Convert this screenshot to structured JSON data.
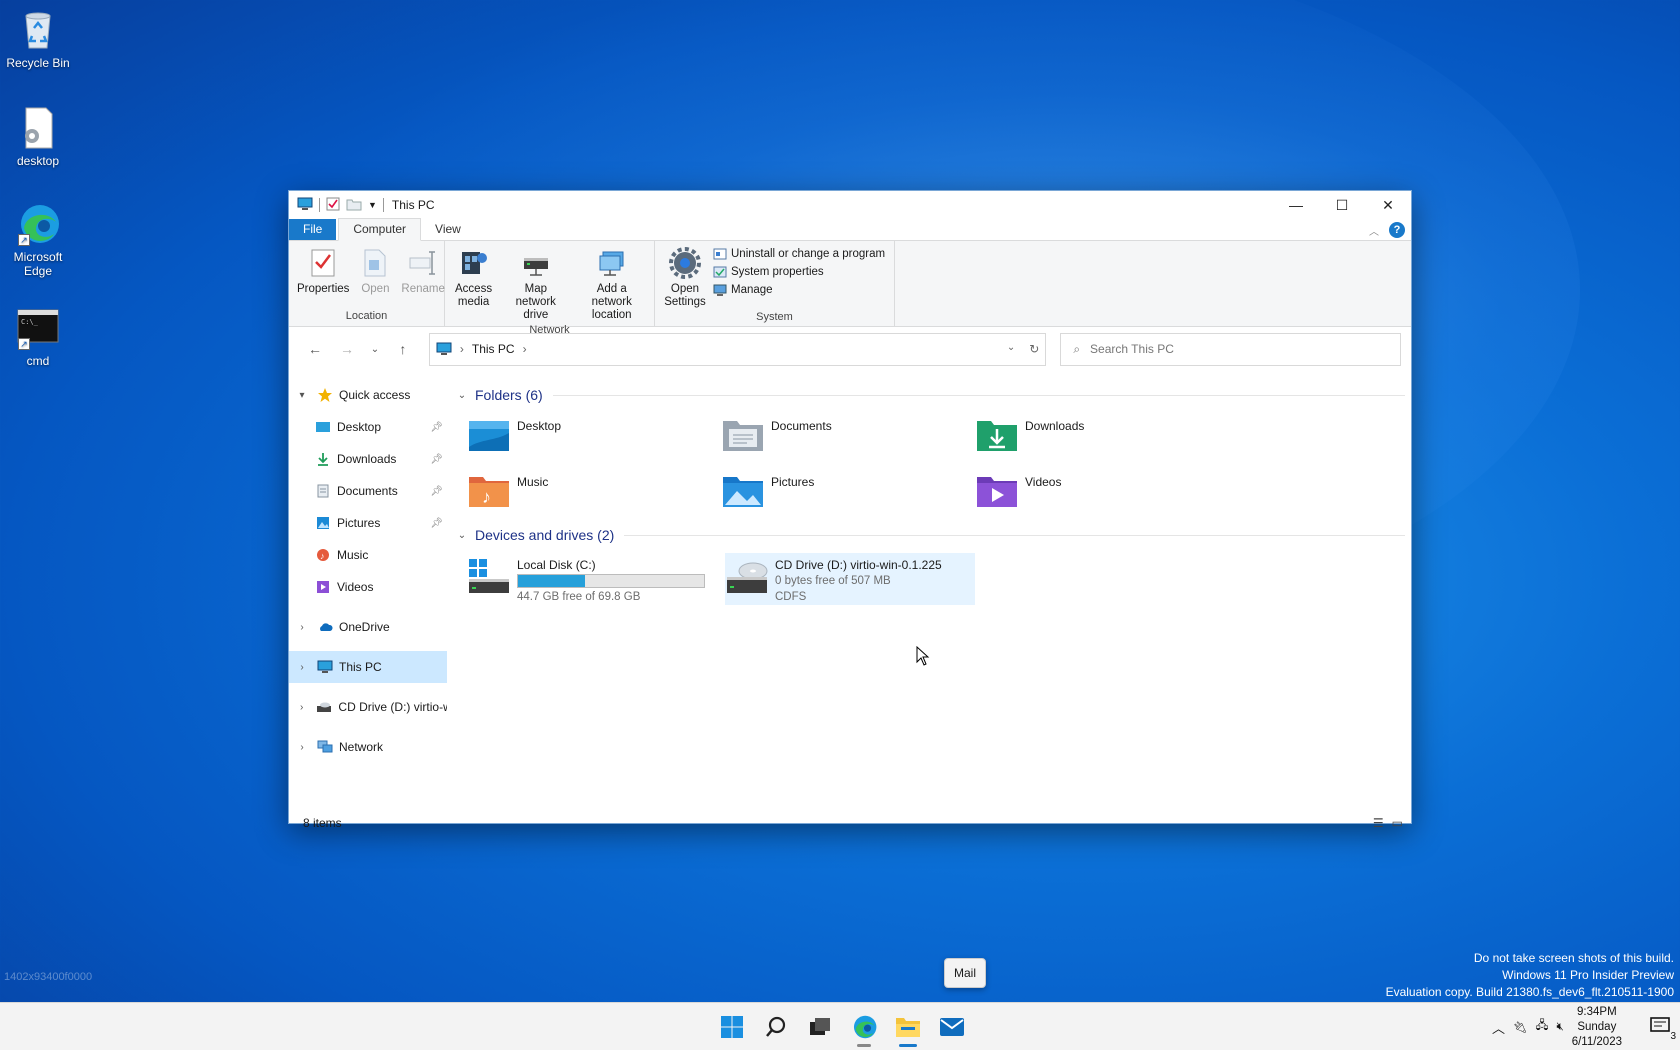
{
  "desktop": {
    "icons": [
      {
        "label": "Recycle Bin"
      },
      {
        "label": "desktop"
      },
      {
        "label": "Microsoft Edge"
      },
      {
        "label": "cmd"
      }
    ],
    "watermark": {
      "line1": "Do not take screen shots of this build.",
      "line2": "Windows 11 Pro Insider Preview",
      "line3": "Evaluation copy. Build 21380.fs_dev6_flt.210511-1900"
    },
    "faint_text": "1402x93400f0000"
  },
  "window": {
    "title": "This PC",
    "ribbon_tabs": [
      "File",
      "Computer",
      "View"
    ],
    "active_tab": "Computer",
    "groups": {
      "location": {
        "label": "Location",
        "buttons": [
          "Properties",
          "Open",
          "Rename"
        ]
      },
      "network": {
        "label": "Network",
        "buttons": [
          "Access media",
          "Map network drive",
          "Add a network location"
        ]
      },
      "system": {
        "label": "System",
        "open_settings": "Open Settings",
        "small": [
          "Uninstall or change a program",
          "System properties",
          "Manage"
        ]
      }
    },
    "address": {
      "path": "This PC",
      "search_placeholder": "Search This PC"
    },
    "nav": {
      "quick_access": "Quick access",
      "items": [
        "Desktop",
        "Downloads",
        "Documents",
        "Pictures",
        "Music",
        "Videos"
      ],
      "onedrive": "OneDrive",
      "this_pc": "This PC",
      "cd_drive": "CD Drive (D:) virtio-w",
      "network": "Network"
    },
    "folders_header": "Folders (6)",
    "folders": [
      "Desktop",
      "Documents",
      "Downloads",
      "Music",
      "Pictures",
      "Videos"
    ],
    "drives_header": "Devices and drives (2)",
    "drives": [
      {
        "name": "Local Disk (C:)",
        "free": "44.7 GB free of 69.8 GB",
        "used_fraction": 0.36
      },
      {
        "name": "CD Drive (D:) virtio-win-0.1.225",
        "free": "0 bytes free of 507 MB",
        "fs": "CDFS"
      }
    ],
    "status": "8 items"
  },
  "taskbar": {
    "tooltip": "Mail",
    "time": "9:34PM",
    "day": "Sunday",
    "date": "6/11/2023",
    "notification_count": "3"
  },
  "colors": {
    "accent": "#1979ca",
    "selection": "#cce8ff",
    "progress": "#26a0da"
  }
}
